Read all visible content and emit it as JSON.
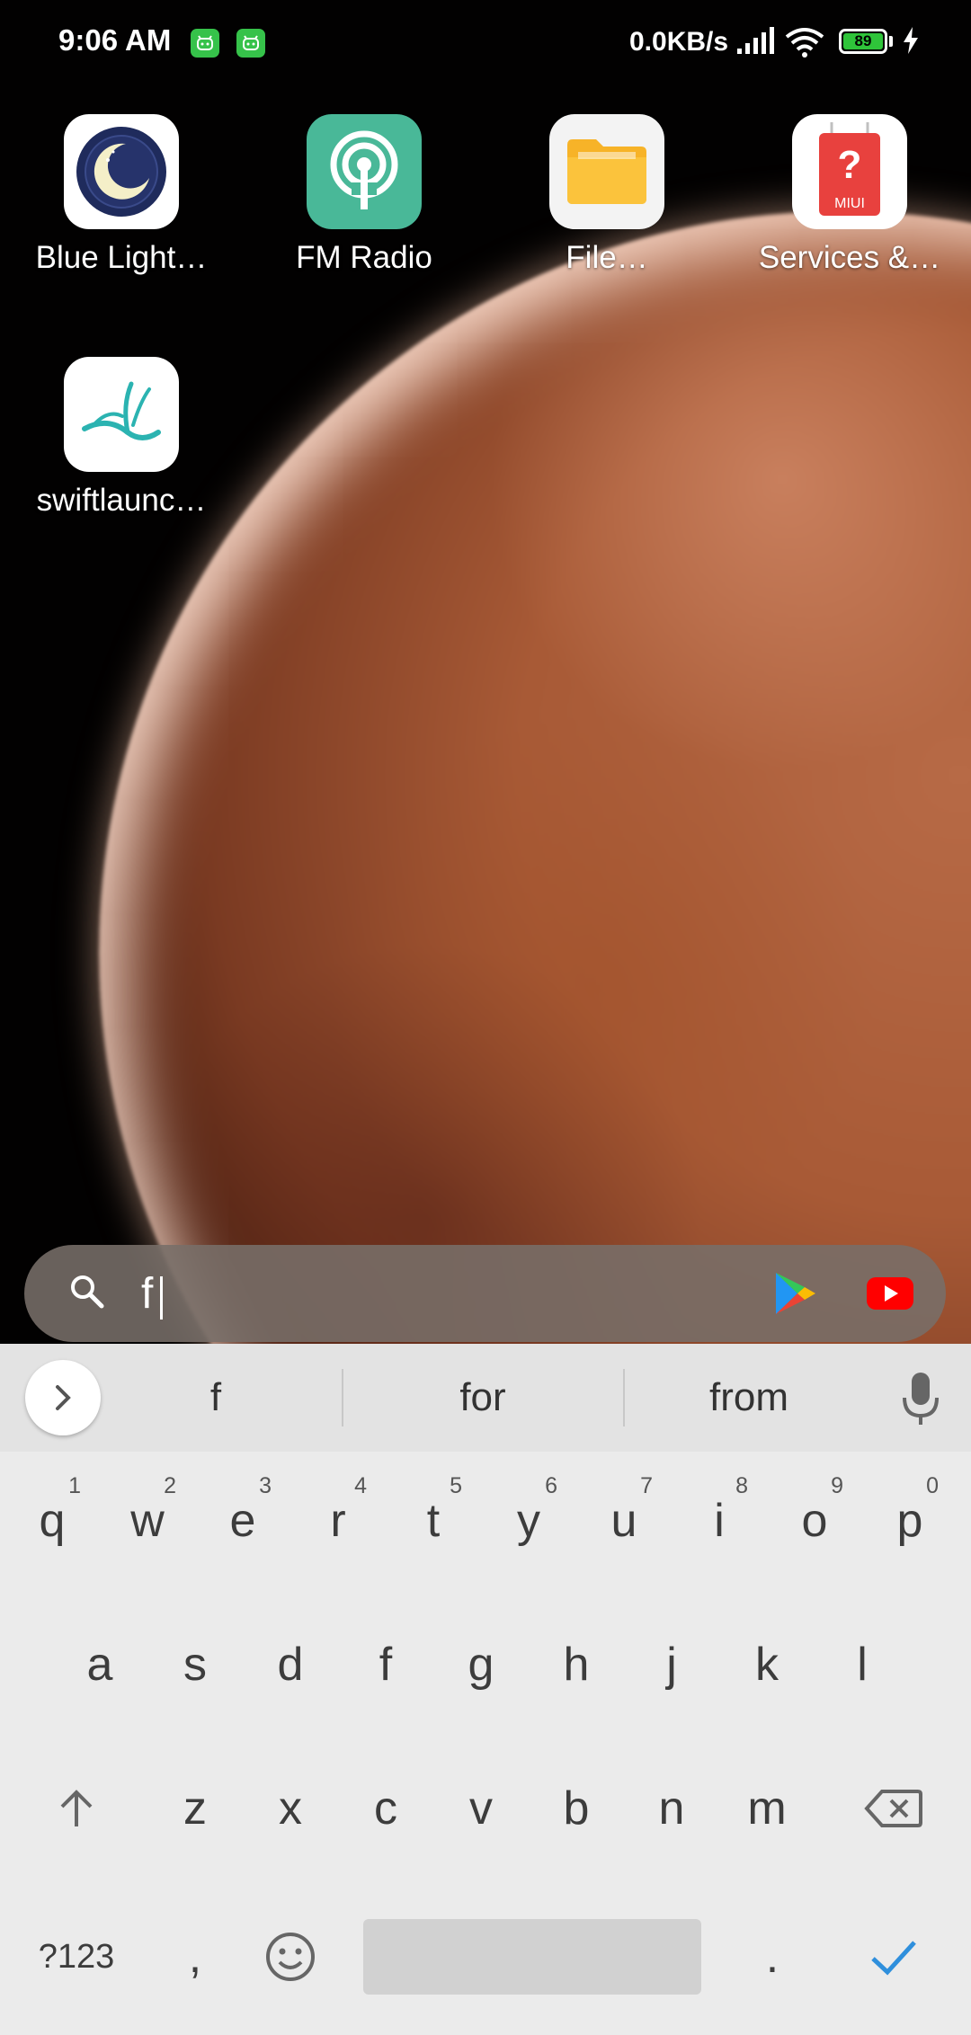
{
  "status_bar": {
    "time": "9:06 AM",
    "network_speed": "0.0KB/s",
    "battery_level": "89",
    "notification_icons": [
      "android-notification-icon",
      "android-notification-icon"
    ]
  },
  "home_apps": [
    {
      "label": "Blue Light…",
      "icon": "moon-icon"
    },
    {
      "label": "FM Radio",
      "icon": "radio-icon"
    },
    {
      "label": "File…",
      "icon": "folder-icon"
    },
    {
      "label": "Services &…",
      "icon": "miui-help-icon"
    },
    {
      "label": "swiftlaunc…",
      "icon": "swiftlauncher-icon"
    }
  ],
  "search": {
    "value": "f",
    "shortcuts": [
      "play-store-icon",
      "youtube-icon"
    ]
  },
  "keyboard": {
    "suggestions": [
      "f",
      "for",
      "from"
    ],
    "row1": [
      {
        "k": "q",
        "h": "1"
      },
      {
        "k": "w",
        "h": "2"
      },
      {
        "k": "e",
        "h": "3"
      },
      {
        "k": "r",
        "h": "4"
      },
      {
        "k": "t",
        "h": "5"
      },
      {
        "k": "y",
        "h": "6"
      },
      {
        "k": "u",
        "h": "7"
      },
      {
        "k": "i",
        "h": "8"
      },
      {
        "k": "o",
        "h": "9"
      },
      {
        "k": "p",
        "h": "0"
      }
    ],
    "row2": [
      "a",
      "s",
      "d",
      "f",
      "g",
      "h",
      "j",
      "k",
      "l"
    ],
    "row3": [
      "z",
      "x",
      "c",
      "v",
      "b",
      "n",
      "m"
    ],
    "symbols_label": "?123",
    "comma": ",",
    "period": "."
  },
  "colors": {
    "accent": "#2f8fdc",
    "battery_fill": "#2fc43a",
    "fm_radio": "#49b898",
    "files": "#f7b328",
    "services": "#e8413e",
    "youtube": "#ff0000"
  }
}
